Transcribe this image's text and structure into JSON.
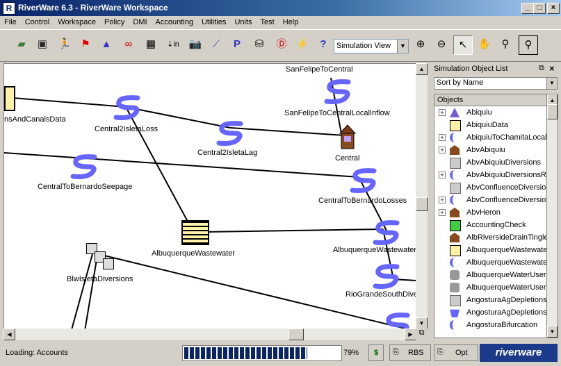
{
  "window": {
    "title": "RiverWare 6.3 - RiverWare Workspace"
  },
  "menu": [
    "File",
    "Control",
    "Workspace",
    "Policy",
    "DMI",
    "Accounting",
    "Utilities",
    "Units",
    "Test",
    "Help"
  ],
  "toolbar": {
    "view_select": "Simulation View"
  },
  "canvas": {
    "nodes": [
      {
        "label": "nsAndCanalsData"
      },
      {
        "label": "Central2IsletaLoss"
      },
      {
        "label": "SanFelipeToCentral"
      },
      {
        "label": "SanFelipeToCentralLocalInflow"
      },
      {
        "label": "Central2IsletaLag"
      },
      {
        "label": "Central"
      },
      {
        "label": "CentralToBernardoSeepage"
      },
      {
        "label": "CentralToBernardoLosses"
      },
      {
        "label": "AlbuquerqueWastewater"
      },
      {
        "label": "AlbuquerqueWastewaterI"
      },
      {
        "label": "BlwIsletaDiversions"
      },
      {
        "label": "RioGrandeSouthDiver"
      }
    ]
  },
  "panel": {
    "title": "Simulation Object List",
    "sort": "Sort by Name",
    "header": "Objects",
    "items": [
      {
        "label": "Abiquiu",
        "expand": true,
        "icon": "reservoir-icon"
      },
      {
        "label": "AbiquiuData",
        "expand": false,
        "icon": "data-object-icon"
      },
      {
        "label": "AbiquiuToChamitaLocalI",
        "expand": true,
        "icon": "reach-icon"
      },
      {
        "label": "AbvAbiquiu",
        "expand": true,
        "icon": "control-point-icon"
      },
      {
        "label": "AbvAbiquiuDiversions",
        "expand": false,
        "icon": "diversion-icon"
      },
      {
        "label": "AbvAbiquiuDiversionsRe",
        "expand": true,
        "icon": "reach-icon"
      },
      {
        "label": "AbvConfluenceDiversion",
        "expand": false,
        "icon": "diversion-icon"
      },
      {
        "label": "AbvConfluenceDiversion",
        "expand": true,
        "icon": "reach-icon"
      },
      {
        "label": "AbvHeron",
        "expand": true,
        "icon": "control-point-icon"
      },
      {
        "label": "AccountingCheck",
        "expand": false,
        "icon": "data-object-green-icon"
      },
      {
        "label": "AlbRiversideDrainTingle",
        "expand": false,
        "icon": "control-point-icon"
      },
      {
        "label": "AlbuquerqueWastewate",
        "expand": false,
        "icon": "data-object-icon"
      },
      {
        "label": "AlbuquerqueWastewate",
        "expand": false,
        "icon": "reach-icon"
      },
      {
        "label": "AlbuquerqueWaterUser",
        "expand": false,
        "icon": "water-user-icon"
      },
      {
        "label": "AlbuquerqueWaterUser",
        "expand": false,
        "icon": "water-user-icon"
      },
      {
        "label": "AngosturaAgDepletions",
        "expand": false,
        "icon": "diversion-icon"
      },
      {
        "label": "AngosturaAgDepletions",
        "expand": false,
        "icon": "bucket-icon"
      },
      {
        "label": "AngosturaBifurcation",
        "expand": false,
        "icon": "bifurcation-icon"
      }
    ]
  },
  "status": {
    "text": "Loading: Accounts",
    "progress_pct": 79,
    "progress_label": "79%",
    "rbs": "RBS",
    "opt": "Opt",
    "brand": "riverware"
  },
  "colors": {
    "reach": "#6666ff",
    "data": "#fff2a8",
    "title": "#0a246a"
  }
}
